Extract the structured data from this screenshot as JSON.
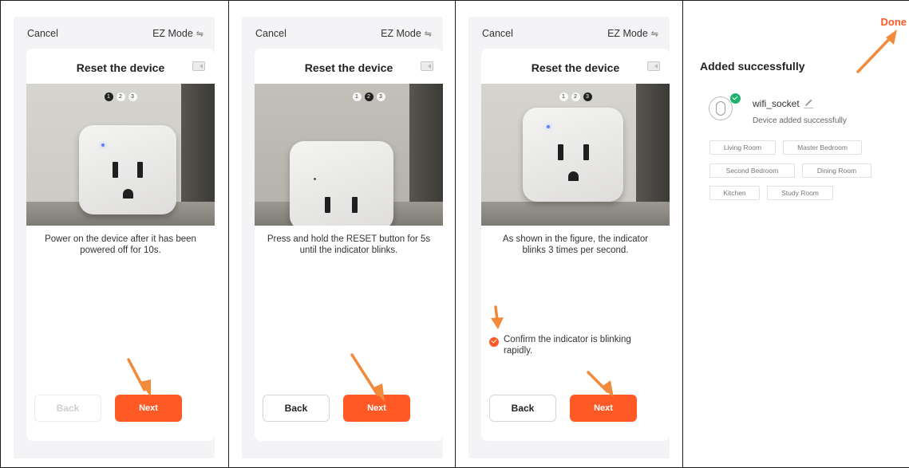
{
  "panels": [
    {
      "header": {
        "cancel": "Cancel",
        "mode": "EZ Mode",
        "mode_icon": "swap-icon"
      },
      "title": "Reset the device",
      "steps": [
        "1",
        "2",
        "3"
      ],
      "active_step": 1,
      "description": "Power on the device after it has been powered off for 10s.",
      "back_label": "Back",
      "back_disabled": true,
      "next_label": "Next"
    },
    {
      "header": {
        "cancel": "Cancel",
        "mode": "EZ Mode",
        "mode_icon": "swap-icon"
      },
      "title": "Reset the device",
      "steps": [
        "1",
        "2",
        "3"
      ],
      "active_step": 2,
      "description": "Press and hold the RESET button for 5s until the indicator blinks.",
      "back_label": "Back",
      "back_disabled": false,
      "next_label": "Next"
    },
    {
      "header": {
        "cancel": "Cancel",
        "mode": "EZ Mode",
        "mode_icon": "swap-icon"
      },
      "title": "Reset the device",
      "steps": [
        "1",
        "2",
        "3"
      ],
      "active_step": 3,
      "description": "As shown in the figure, the indicator blinks 3 times per second.",
      "confirm_text": "Confirm the indicator is blinking rapidly.",
      "confirm_checked": true,
      "back_label": "Back",
      "back_disabled": false,
      "next_label": "Next"
    }
  ],
  "result": {
    "done_label": "Done",
    "title": "Added successfully",
    "device_name": "wifi_socket",
    "device_status": "Device added successfully",
    "rooms": [
      "Living Room",
      "Master Bedroom",
      "Second Bedroom",
      "Dining Room",
      "Kitchen",
      "Study Room"
    ]
  },
  "colors": {
    "accent": "#ff5a26",
    "success": "#23b26d",
    "arrow": "#f28a3c"
  }
}
